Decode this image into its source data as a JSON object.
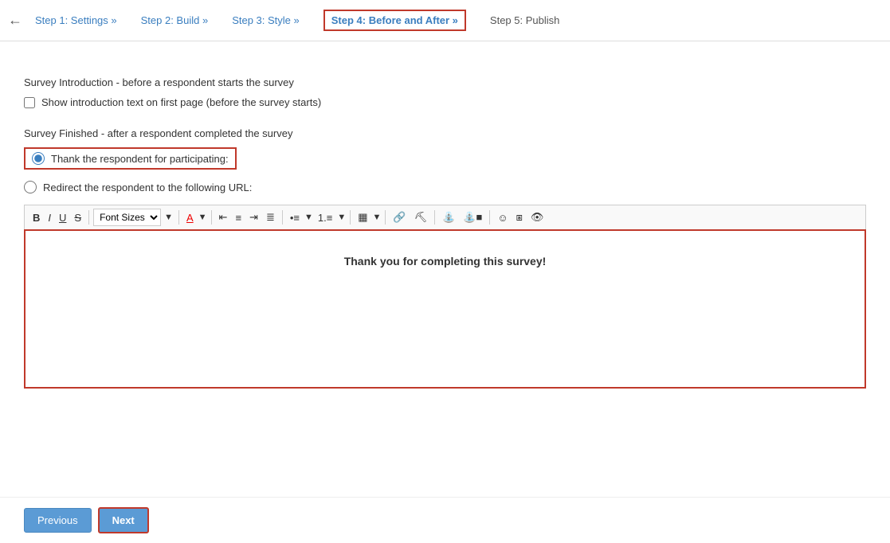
{
  "nav": {
    "back_icon": "←",
    "steps": [
      {
        "label": "Step 1: Settings »",
        "state": "normal",
        "id": "step1"
      },
      {
        "label": "Step 2: Build »",
        "state": "normal",
        "id": "step2"
      },
      {
        "label": "Step 3: Style »",
        "state": "normal",
        "id": "step3"
      },
      {
        "label": "Step 4: Before and After »",
        "state": "active",
        "id": "step4"
      },
      {
        "label": "Step 5: Publish",
        "state": "disabled",
        "id": "step5"
      }
    ]
  },
  "intro_section": {
    "title": "Survey Introduction - before a respondent starts the survey",
    "checkbox_label": "Show introduction text on first page (before the survey starts)"
  },
  "finished_section": {
    "title": "Survey Finished - after a respondent completed the survey",
    "radio1_label": "Thank the respondent for participating:",
    "radio2_label": "Redirect the respondent to the following URL:"
  },
  "editor": {
    "content": "Thank you for completing this survey!",
    "toolbar": {
      "bold": "B",
      "italic": "I",
      "underline": "U",
      "strikethrough": "S",
      "font_sizes": "Font Sizes",
      "font_color": "A",
      "align_left": "≡",
      "align_center": "≡",
      "align_right": "≡",
      "align_justify": "≡",
      "bullet_list": "≡",
      "numbered_list": "≡",
      "table": "⊞",
      "link": "🔗",
      "unlink": "⛓",
      "image": "🖼",
      "image2": "🖼",
      "emoji": "☺",
      "fullscreen": "⤢",
      "preview": "👁"
    }
  },
  "buttons": {
    "previous": "Previous",
    "next": "Next"
  }
}
